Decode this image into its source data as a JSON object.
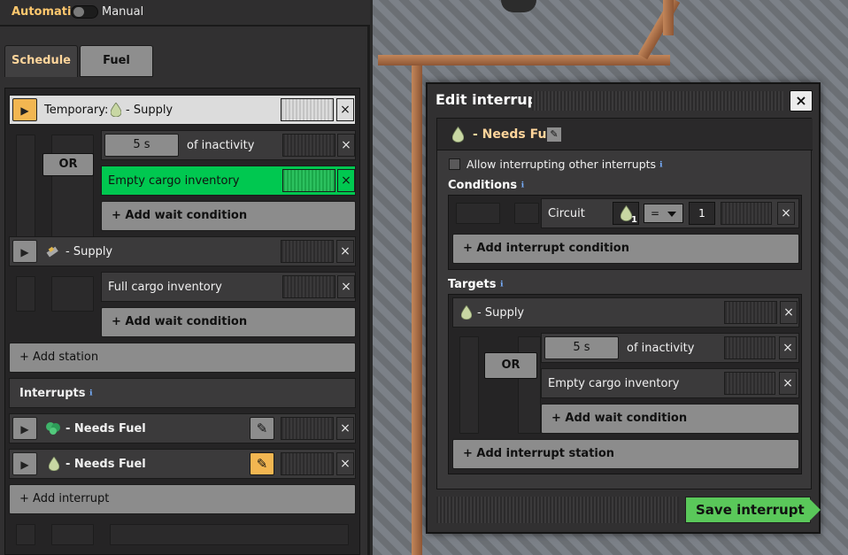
{
  "topbar": {
    "mode_automatic": "Automatic",
    "mode_manual": "Manual"
  },
  "tabs": [
    {
      "label": "Schedule"
    },
    {
      "label": "Fuel"
    }
  ],
  "schedule": {
    "temporary_stop": {
      "prefix": "Temporary:",
      "name": "- Supply"
    },
    "temporary_conditions": [
      {
        "time": "5 s",
        "label": "of inactivity"
      },
      {
        "label": "Empty cargo inventory"
      }
    ],
    "or_label": "OR",
    "add_wait_condition": "+ Add wait condition",
    "station": {
      "name": "- Supply"
    },
    "station_conditions": [
      {
        "label": "Full cargo inventory"
      }
    ],
    "add_station": "+ Add station",
    "interrupts_label": "Interrupts",
    "interrupts": [
      {
        "name": "- Needs Fuel"
      },
      {
        "name": "- Needs Fuel"
      }
    ],
    "add_interrupt": "+ Add interrupt"
  },
  "dialog": {
    "title": "Edit interrupt",
    "close_icon": "×",
    "interrupt_name": "- Needs Fuel",
    "allow_label": "Allow interrupting other interrupts",
    "conditions_label": "Conditions",
    "condition": {
      "type": "Circuit",
      "signal_count": "1",
      "operator": "=",
      "value": "1"
    },
    "add_interrupt_condition": "+ Add interrupt condition",
    "targets_label": "Targets",
    "target": {
      "name": "- Supply"
    },
    "target_conditions": [
      {
        "time": "5 s",
        "label": "of inactivity"
      },
      {
        "label": "Empty cargo inventory"
      }
    ],
    "or_label": "OR",
    "add_wait_condition": "+ Add wait condition",
    "add_interrupt_station": "+ Add interrupt station",
    "save_label": "Save interrupt"
  },
  "glyphs": {
    "close": "×",
    "play": "▶",
    "pencil": "✎"
  },
  "colors": {
    "accent_orange": "#f2b651",
    "title_orange": "#ffc86e",
    "active_green": "#00c850",
    "save_green": "#5ac85a",
    "info_blue": "#78b0ff"
  },
  "icons": [
    "play-icon",
    "close-icon",
    "fluid-drop-icon",
    "green-fuel-icon",
    "locomotive-icon",
    "pencil-icon",
    "info-icon",
    "dropdown-arrow-icon"
  ]
}
